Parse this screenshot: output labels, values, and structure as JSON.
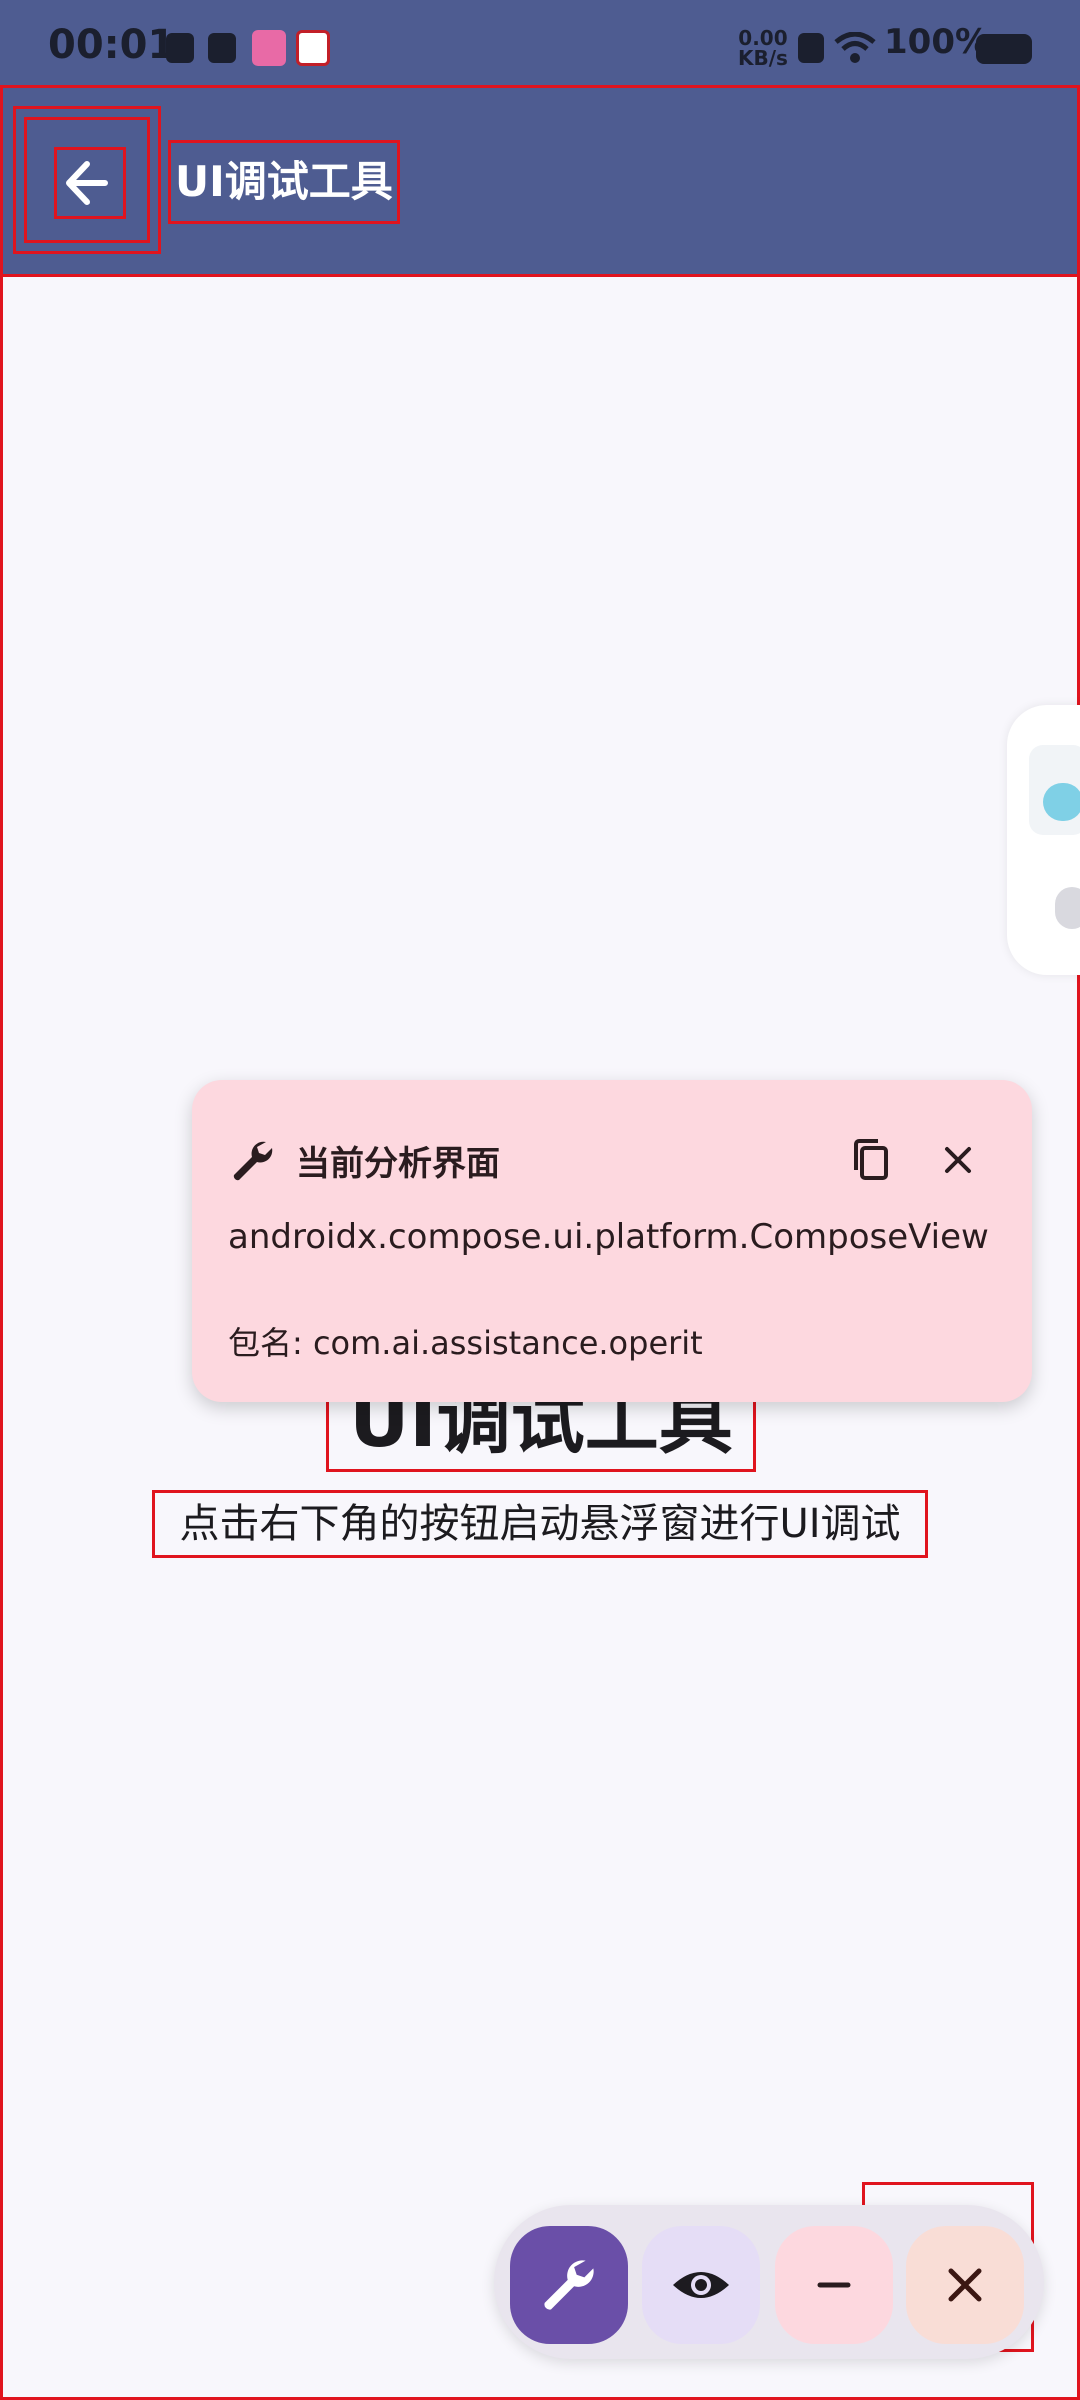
{
  "status_bar": {
    "time": "00:01",
    "net_speed_value": "0.00",
    "net_speed_unit": "KB/s",
    "battery": "100%"
  },
  "toolbar": {
    "title": "UI调试工具",
    "back_icon": "arrow-left-icon"
  },
  "analysis_card": {
    "title": "当前分析界面",
    "view_class": "androidx.compose.ui.platform.ComposeView",
    "package_line": "包名: com.ai.assistance.operit",
    "icons": [
      "wrench-icon",
      "copy-icon",
      "close-icon"
    ]
  },
  "main": {
    "title": "UI调试工具",
    "subtitle": "点击右下角的按钮启动悬浮窗进行UI调试"
  },
  "fab_bar": {
    "buttons": [
      "wrench-icon",
      "eye-icon",
      "minus-icon",
      "close-icon"
    ]
  },
  "colors": {
    "toolbar": "#4e5c91",
    "card": "#fdd8df",
    "fab_primary": "#6a4fa8",
    "highlight": "#e0141e"
  }
}
